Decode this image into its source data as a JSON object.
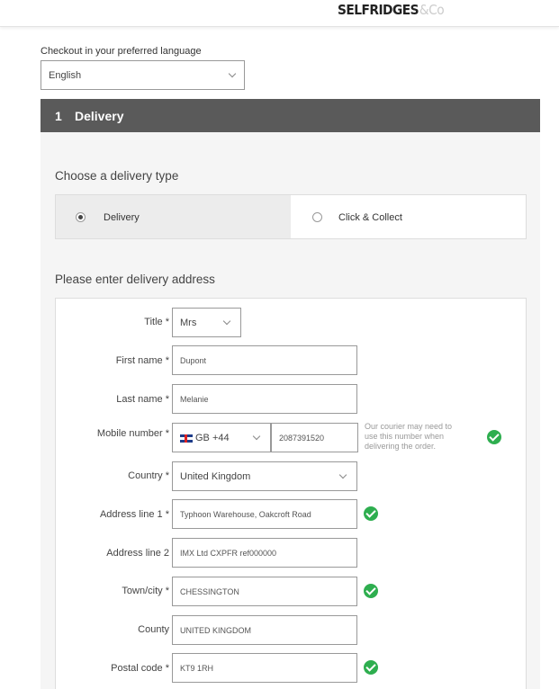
{
  "header": {
    "logo_main": "SELFRIDGES",
    "logo_suffix": "&Co"
  },
  "language": {
    "label": "Checkout in your preferred language",
    "selected": "English"
  },
  "step": {
    "number": "1",
    "title": "Delivery"
  },
  "delivery_type": {
    "title": "Choose a delivery type",
    "options": [
      {
        "label": "Delivery",
        "selected": true
      },
      {
        "label": "Click & Collect",
        "selected": false
      }
    ]
  },
  "address": {
    "title": "Please enter delivery address",
    "fields": {
      "title": {
        "label": "Title *",
        "value": "Mrs"
      },
      "first_name": {
        "label": "First name *",
        "value": "Dupont"
      },
      "last_name": {
        "label": "Last name *",
        "value": "Melanie"
      },
      "mobile": {
        "label": "Mobile number *",
        "country_code": "GB +44",
        "value": "2087391520",
        "hint": "Our courier may need to use this number when delivering the order."
      },
      "country": {
        "label": "Country *",
        "value": "United Kingdom"
      },
      "address1": {
        "label": "Address line 1 *",
        "value": "Typhoon Warehouse, Oakcroft Road"
      },
      "address2": {
        "label": "Address line 2",
        "value": "IMX Ltd CXPFR ref000000"
      },
      "town": {
        "label": "Town/city *",
        "value": "CHESSINGTON"
      },
      "county": {
        "label": "County",
        "value": "UNITED KINGDOM"
      },
      "postal": {
        "label": "Postal code *",
        "value": "KT9 1RH"
      }
    }
  },
  "colors": {
    "step_header": "#5a5a5a",
    "valid": "#2eae4f",
    "panel_bg": "#f5f5f5"
  }
}
